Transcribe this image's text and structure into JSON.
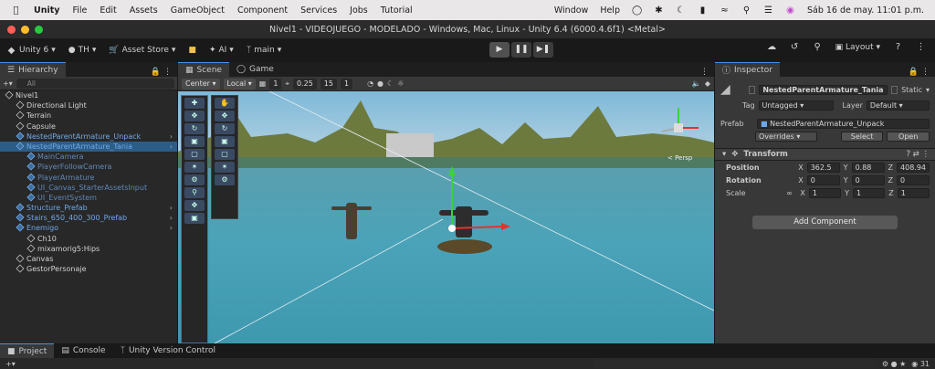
{
  "menubar": {
    "app": "Unity",
    "items": [
      "File",
      "Edit",
      "Assets",
      "GameObject",
      "Component",
      "Services",
      "Jobs",
      "Tutorial"
    ],
    "right_items": [
      "Window",
      "Help"
    ],
    "datetime": "Sáb 16 de may.  11:01 p.m."
  },
  "window": {
    "title": "Nivel1 - VIDEOJUEGO - MODELADO - Windows, Mac, Linux - Unity 6.4 (6000.4.6f1) <Metal>"
  },
  "toolbar": {
    "unity_label": "Unity 6",
    "account": "TH",
    "asset_store": "Asset Store",
    "ai": "AI",
    "branch": "main",
    "layout": "Layout"
  },
  "hierarchy": {
    "tab": "Hierarchy",
    "search_placeholder": "All",
    "rows": [
      {
        "label": "Nivel1",
        "indent": 0,
        "type": "scene"
      },
      {
        "label": "Directional Light",
        "indent": 1,
        "type": "go"
      },
      {
        "label": "Terrain",
        "indent": 1,
        "type": "go"
      },
      {
        "label": "Capsule",
        "indent": 1,
        "type": "go"
      },
      {
        "label": "NestedParentArmature_Unpack",
        "indent": 1,
        "type": "prefab",
        "arrow": true
      },
      {
        "label": "NestedParentArmature_Tania",
        "indent": 1,
        "type": "prefab",
        "selected": true,
        "arrow": true
      },
      {
        "label": "MainCamera",
        "indent": 2,
        "type": "dim"
      },
      {
        "label": "PlayerFollowCamera",
        "indent": 2,
        "type": "dim"
      },
      {
        "label": "PlayerArmature",
        "indent": 2,
        "type": "dim"
      },
      {
        "label": "UI_Canvas_StarterAssetsInput",
        "indent": 2,
        "type": "dim"
      },
      {
        "label": "UI_EventSystem",
        "indent": 2,
        "type": "dim"
      },
      {
        "label": "Structure_Prefab",
        "indent": 1,
        "type": "prefab",
        "arrow": true
      },
      {
        "label": "Stairs_650_400_300_Prefab",
        "indent": 1,
        "type": "prefab",
        "arrow": true
      },
      {
        "label": "Enemigo",
        "indent": 1,
        "type": "prefab",
        "arrow": true
      },
      {
        "label": "Ch10",
        "indent": 2,
        "type": "go"
      },
      {
        "label": "mixamorig5:Hips",
        "indent": 2,
        "type": "go"
      },
      {
        "label": "Canvas",
        "indent": 1,
        "type": "go"
      },
      {
        "label": "GestorPersonaje",
        "indent": 1,
        "type": "go"
      }
    ]
  },
  "scene": {
    "tabs": [
      "Scene",
      "Game"
    ],
    "pivot": "Center",
    "space": "Local",
    "grid_value": "1",
    "snap_value": "0.25",
    "rotate_snap": "15",
    "scale_snap": "1",
    "gizmo_label": "< Persp"
  },
  "inspector": {
    "tab": "Inspector",
    "object_name": "NestedParentArmature_Tania",
    "static_label": "Static",
    "tag_label": "Tag",
    "tag_value": "Untagged",
    "layer_label": "Layer",
    "layer_value": "Default",
    "prefab_label": "Prefab",
    "prefab_value": "NestedParentArmature_Unpack",
    "overrides": "Overrides",
    "select": "Select",
    "open": "Open",
    "transform": {
      "title": "Transform",
      "position_label": "Position",
      "rotation_label": "Rotation",
      "scale_label": "Scale",
      "pos": {
        "x": "362.5",
        "y": "0.88",
        "z": "408.94"
      },
      "rot": {
        "x": "0",
        "y": "0",
        "z": "0"
      },
      "scale": {
        "x": "1",
        "y": "1",
        "z": "1"
      }
    },
    "add_component": "Add Component"
  },
  "bottom": {
    "tabs": [
      "Project",
      "Console",
      "Unity Version Control"
    ],
    "count": "31"
  }
}
